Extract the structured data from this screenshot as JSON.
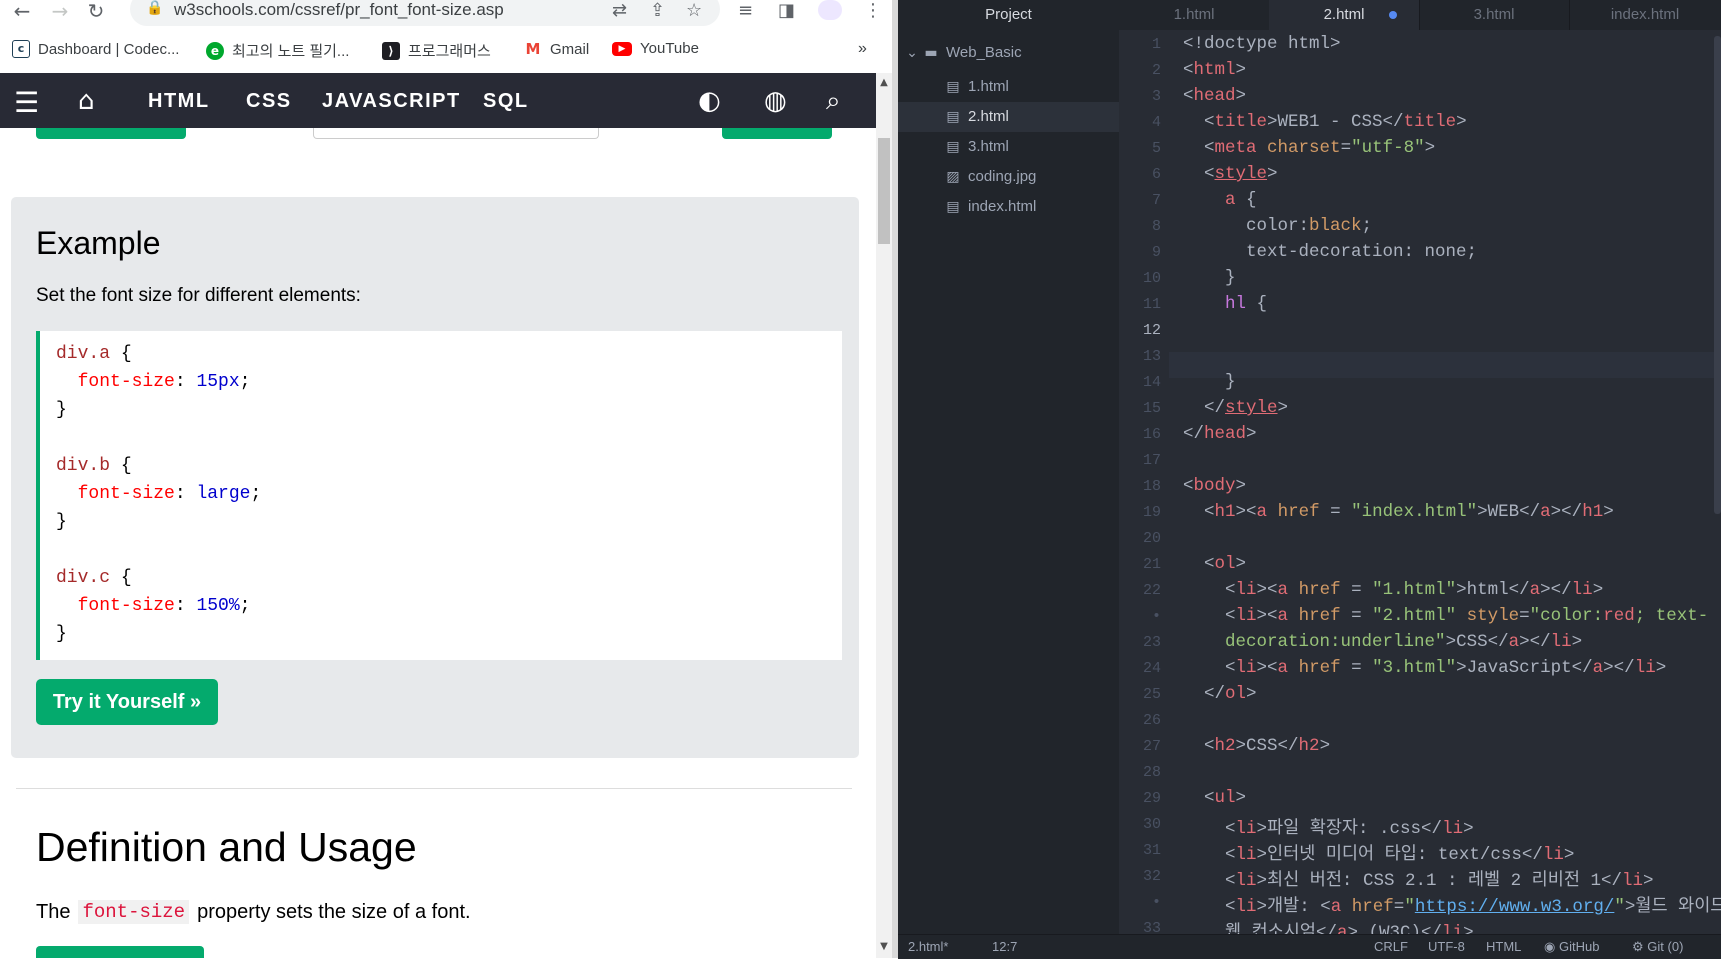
{
  "browser": {
    "url": "w3schools.com/cssref/pr_font_font-size.asp",
    "bookmarks": [
      {
        "label": "Dashboard | Codec...",
        "icon": "codecademy-icon"
      },
      {
        "label": "최고의 노트 필기...",
        "icon": "evernote-icon"
      },
      {
        "label": "프로그래머스",
        "icon": "programmers-icon"
      },
      {
        "label": "Gmail",
        "icon": "gmail-icon"
      },
      {
        "label": "YouTube",
        "icon": "youtube-icon"
      }
    ],
    "bookmarks_more": "»"
  },
  "w3nav": {
    "items": [
      "HTML",
      "CSS",
      "JAVASCRIPT",
      "SQL"
    ]
  },
  "page": {
    "example_title": "Example",
    "example_desc": "Set the font size for different elements:",
    "code": {
      "a_sel": "div.a",
      "a_prop": "font-size",
      "a_val": "15px",
      "b_sel": "div.b",
      "b_prop": "font-size",
      "b_val": "large",
      "c_sel": "div.c",
      "c_prop": "font-size",
      "c_val": "150%"
    },
    "try_button": "Try it Yourself »",
    "def_title": "Definition and Usage",
    "def_pre": "The",
    "def_code": "font-size",
    "def_post": "property sets the size of a font."
  },
  "editor": {
    "tree": {
      "header": "Project",
      "folder": "Web_Basic",
      "files": [
        "1.html",
        "2.html",
        "3.html",
        "coding.jpg",
        "index.html"
      ],
      "active_file": "2.html"
    },
    "tabs": [
      "1.html",
      "2.html",
      "3.html",
      "index.html"
    ],
    "active_tab": "2.html",
    "line_numbers": [
      "1",
      "2",
      "3",
      "4",
      "5",
      "6",
      "7",
      "8",
      "9",
      "10",
      "11",
      "12",
      "13",
      "14",
      "15",
      "16",
      "17",
      "18",
      "19",
      "20",
      "21",
      "22",
      "•",
      "23",
      "24",
      "25",
      "26",
      "27",
      "28",
      "29",
      "30",
      "31",
      "32",
      "•",
      "33"
    ],
    "current_line": "12",
    "status": {
      "file": "2.html*",
      "cursor": "12:7",
      "line_ending": "CRLF",
      "encoding": "UTF-8",
      "grammar": "HTML",
      "github": "GitHub",
      "git": "Git (0)"
    }
  },
  "colors": {
    "w3_green": "#04aa6d",
    "w3_nav_bg": "#282a35",
    "editor_bg": "#282c34",
    "tree_bg": "#21252b",
    "modified_dot": "#568af2"
  }
}
